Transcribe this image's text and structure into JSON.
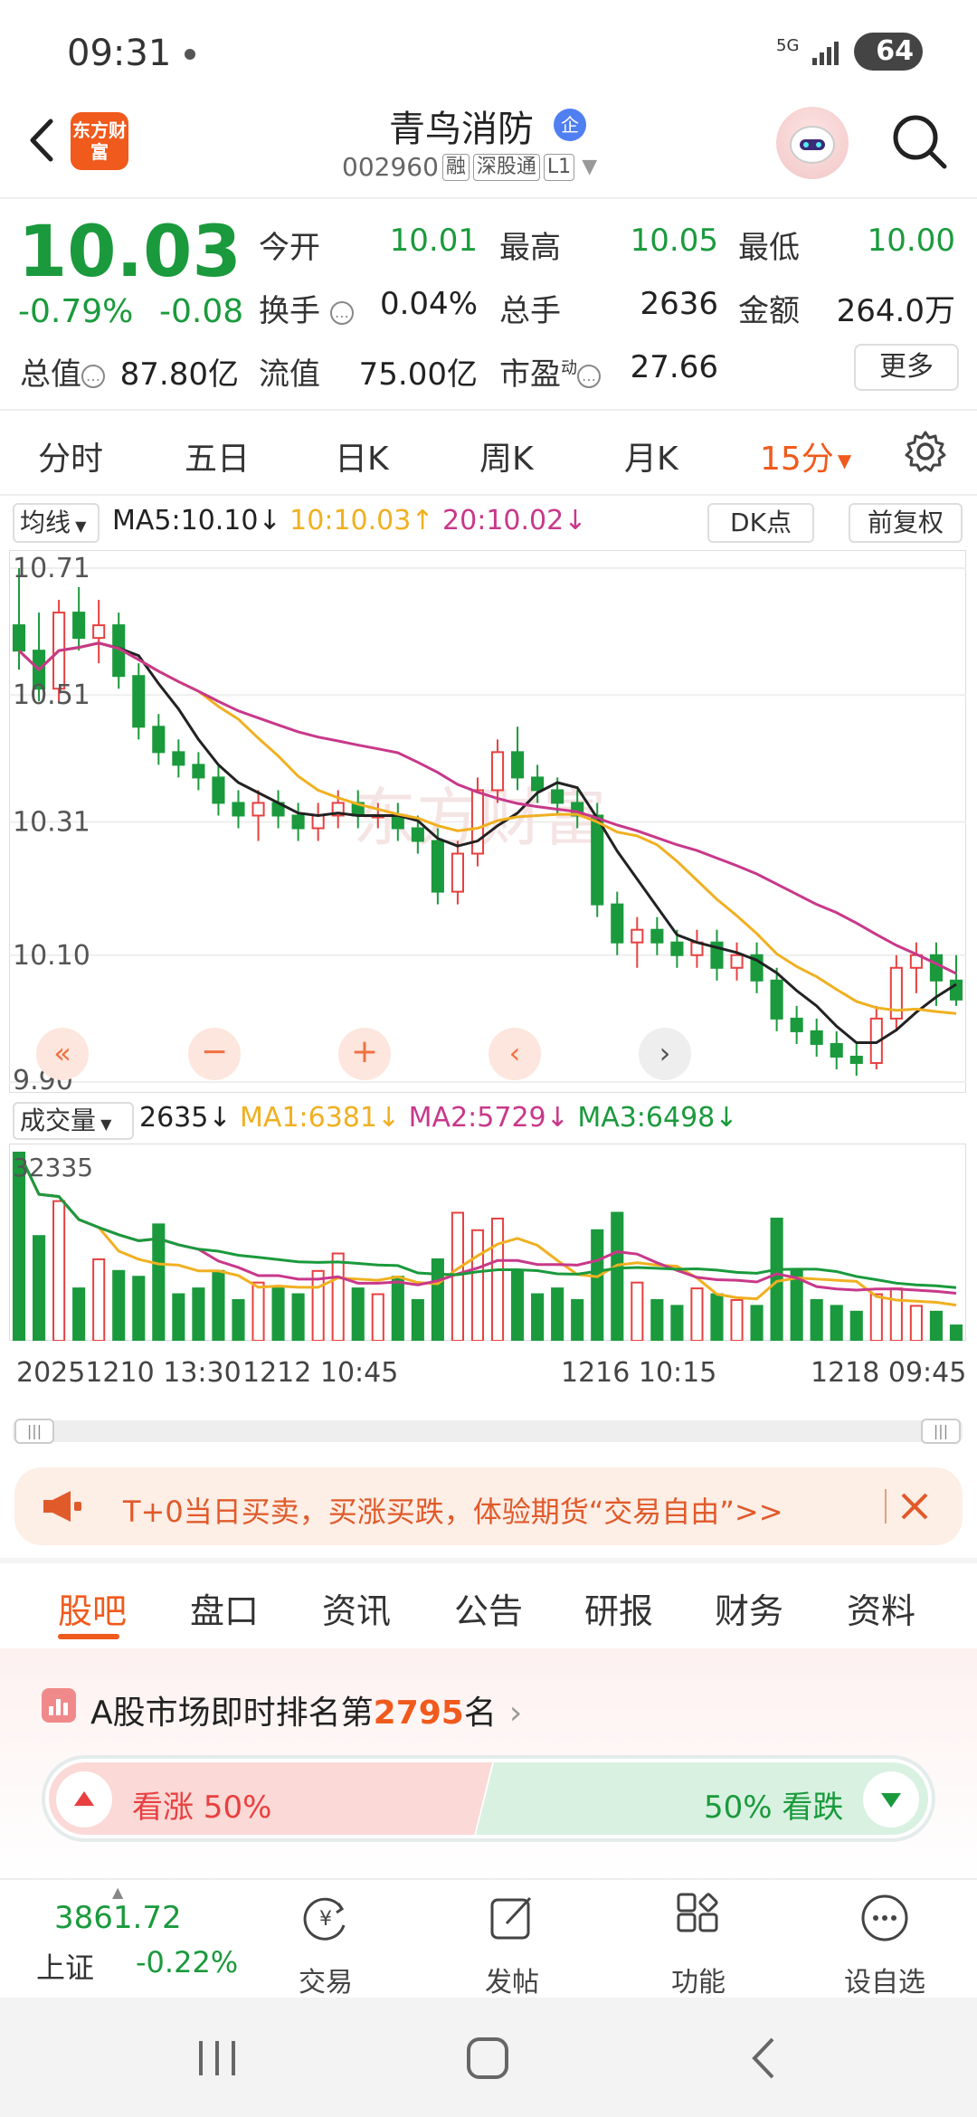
{
  "status_bar": {
    "time": "09:31",
    "network": "5G",
    "battery": "64"
  },
  "header": {
    "brand_logo": "东方财富",
    "stock_name": "青鸟消防",
    "name_badge": "企",
    "stock_code": "002960",
    "tags": [
      "融",
      "深股通",
      "L1"
    ]
  },
  "quote": {
    "price": "10.03",
    "pct_change": "-0.79%",
    "abs_change": "-0.08",
    "fields": [
      {
        "label": "今开",
        "value": "10.01",
        "tone": "down"
      },
      {
        "label": "最高",
        "value": "10.05",
        "tone": "down"
      },
      {
        "label": "最低",
        "value": "10.00",
        "tone": "down"
      },
      {
        "label": "换手",
        "value": "0.04%",
        "tone": "neutral"
      },
      {
        "label": "总手",
        "value": "2636",
        "tone": "neutral"
      },
      {
        "label": "金额",
        "value": "264.0万",
        "tone": "neutral"
      },
      {
        "label": "总值",
        "value": "87.80亿",
        "tone": "neutral"
      },
      {
        "label": "流值",
        "value": "75.00亿",
        "tone": "neutral"
      },
      {
        "label": "市盈",
        "value": "27.66",
        "tone": "neutral"
      }
    ],
    "pe_superscript": "动",
    "more_label": "更多"
  },
  "period_tabs": [
    "分时",
    "五日",
    "日K",
    "周K",
    "月K",
    "15分"
  ],
  "chart_controls": {
    "ma_select": "均线",
    "ma5": "MA5:10.10↓",
    "ma10": "10:10.03↑",
    "ma20": "20:10.02↓",
    "dk_label": "DK点",
    "fq_label": "前复权",
    "y_ticks": [
      "10.71",
      "10.51",
      "10.31",
      "10.10",
      "9.90"
    ],
    "watermark": "东方财富"
  },
  "volume_controls": {
    "vol_select": "成交量",
    "vol_value": "2635↓",
    "ma1": "MA1:6381↓",
    "ma2": "MA2:5729↓",
    "ma3": "MA3:6498↓",
    "max_label": "32335"
  },
  "dates": [
    "20251210 13:30",
    "1212 10:45",
    "1216 10:15",
    "1218 09:45"
  ],
  "colors": {
    "up": "#e84040",
    "down": "#1a9a3c",
    "ma5": "#222222",
    "ma10": "#f0b020",
    "ma20": "#c8388a",
    "accent": "#f05a1c"
  },
  "chart_data": {
    "type": "candlestick",
    "ylim": [
      9.9,
      10.71
    ],
    "ohlc": [
      [
        10.62,
        10.71,
        10.55,
        10.58
      ],
      [
        10.58,
        10.64,
        10.5,
        10.52
      ],
      [
        10.52,
        10.66,
        10.5,
        10.64
      ],
      [
        10.64,
        10.68,
        10.58,
        10.6
      ],
      [
        10.6,
        10.66,
        10.56,
        10.62
      ],
      [
        10.62,
        10.64,
        10.52,
        10.54
      ],
      [
        10.54,
        10.56,
        10.44,
        10.46
      ],
      [
        10.46,
        10.48,
        10.4,
        10.42
      ],
      [
        10.42,
        10.44,
        10.38,
        10.4
      ],
      [
        10.4,
        10.42,
        10.36,
        10.38
      ],
      [
        10.38,
        10.4,
        10.32,
        10.34
      ],
      [
        10.34,
        10.36,
        10.3,
        10.32
      ],
      [
        10.32,
        10.36,
        10.28,
        10.34
      ],
      [
        10.34,
        10.36,
        10.3,
        10.32
      ],
      [
        10.32,
        10.34,
        10.28,
        10.3
      ],
      [
        10.3,
        10.34,
        10.28,
        10.32
      ],
      [
        10.32,
        10.36,
        10.3,
        10.34
      ],
      [
        10.34,
        10.36,
        10.3,
        10.32
      ],
      [
        10.32,
        10.34,
        10.3,
        10.32
      ],
      [
        10.32,
        10.34,
        10.28,
        10.3
      ],
      [
        10.3,
        10.32,
        10.26,
        10.28
      ],
      [
        10.28,
        10.3,
        10.18,
        10.2
      ],
      [
        10.2,
        10.28,
        10.18,
        10.26
      ],
      [
        10.26,
        10.38,
        10.24,
        10.36
      ],
      [
        10.36,
        10.44,
        10.34,
        10.42
      ],
      [
        10.42,
        10.46,
        10.36,
        10.38
      ],
      [
        10.38,
        10.4,
        10.34,
        10.36
      ],
      [
        10.36,
        10.38,
        10.32,
        10.34
      ],
      [
        10.34,
        10.36,
        10.3,
        10.32
      ],
      [
        10.32,
        10.34,
        10.16,
        10.18
      ],
      [
        10.18,
        10.2,
        10.1,
        10.12
      ],
      [
        10.12,
        10.16,
        10.08,
        10.14
      ],
      [
        10.14,
        10.16,
        10.1,
        10.12
      ],
      [
        10.12,
        10.14,
        10.08,
        10.1
      ],
      [
        10.1,
        10.14,
        10.08,
        10.12
      ],
      [
        10.12,
        10.14,
        10.06,
        10.08
      ],
      [
        10.08,
        10.12,
        10.06,
        10.1
      ],
      [
        10.1,
        10.12,
        10.04,
        10.06
      ],
      [
        10.06,
        10.08,
        9.98,
        10.0
      ],
      [
        10.0,
        10.02,
        9.96,
        9.98
      ],
      [
        9.98,
        10.0,
        9.94,
        9.96
      ],
      [
        9.96,
        9.98,
        9.92,
        9.94
      ],
      [
        9.94,
        9.96,
        9.91,
        9.93
      ],
      [
        9.93,
        10.02,
        9.92,
        10.0
      ],
      [
        10.0,
        10.1,
        9.98,
        10.08
      ],
      [
        10.08,
        10.12,
        10.04,
        10.1
      ],
      [
        10.1,
        10.12,
        10.02,
        10.06
      ],
      [
        10.06,
        10.1,
        10.02,
        10.03
      ]
    ],
    "volume": [
      32335,
      18000,
      24000,
      9000,
      14000,
      12000,
      11000,
      20000,
      8000,
      9000,
      12000,
      7000,
      10000,
      9000,
      8000,
      12000,
      15000,
      9000,
      8000,
      11000,
      7000,
      14000,
      22000,
      19000,
      21000,
      12000,
      8000,
      9000,
      7000,
      19000,
      22000,
      10000,
      7000,
      6000,
      9000,
      8000,
      7000,
      6000,
      21000,
      12000,
      7000,
      6000,
      5000,
      8000,
      9000,
      6000,
      5000,
      2635
    ]
  },
  "promo": {
    "text": "T+0当日买卖，买涨买跌，体验期货“交易自由”>>"
  },
  "bottom_tabs": [
    "股吧",
    "盘口",
    "资讯",
    "公告",
    "研报",
    "财务",
    "资料"
  ],
  "rank": {
    "prefix": "A股市场即时排名第",
    "number": "2795",
    "suffix": "名"
  },
  "sentiment": {
    "up_label": "看涨 50%",
    "down_label": "50% 看跌",
    "up_pct": 50,
    "down_pct": 50
  },
  "bottom_nav": {
    "index_value": "3861.72",
    "index_name": "上证",
    "index_change": "-0.22%",
    "items": [
      "交易",
      "发帖",
      "功能",
      "设自选"
    ]
  }
}
